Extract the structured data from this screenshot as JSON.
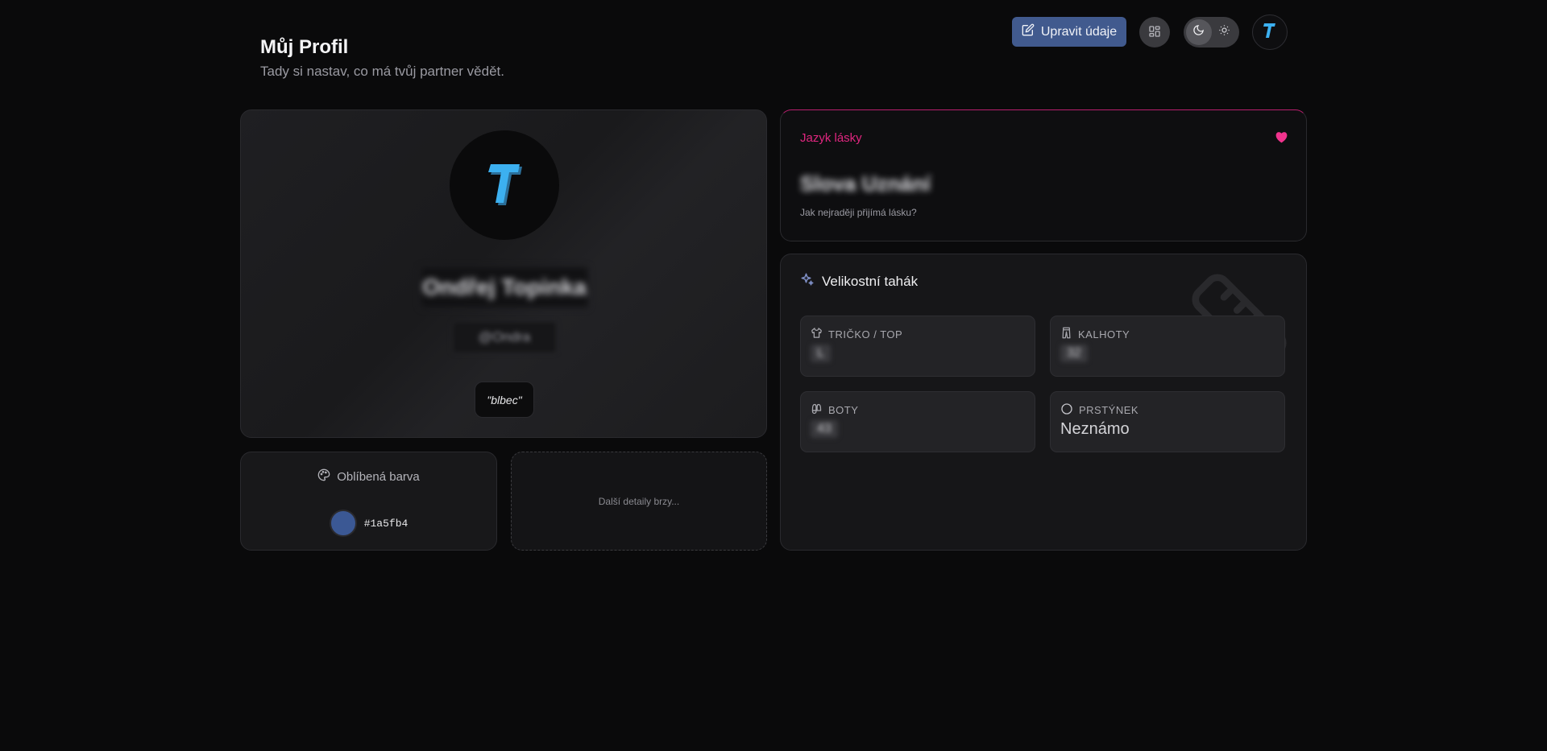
{
  "header": {
    "title": "Můj Profil",
    "subtitle": "Tady si nastav, co má tvůj partner vědět.",
    "edit_button": "Upravit údaje",
    "avatar_letter": "T"
  },
  "profile": {
    "avatar_letter": "T",
    "name": "Ondřej Topinka",
    "handle": "@Ondra",
    "quote": "\"blbec\""
  },
  "love_language": {
    "label": "Jazyk lásky",
    "value": "Slova Uznání",
    "caption": "Jak nejraději přijímá lásku?"
  },
  "sizes": {
    "title": "Velikostní tahák",
    "items": [
      {
        "label": "TRIČKO / TOP",
        "value": "L",
        "icon": "shirt-icon"
      },
      {
        "label": "KALHOTY",
        "value": "32",
        "icon": "pants-icon"
      },
      {
        "label": "BOTY",
        "value": "43",
        "icon": "shoe-icon"
      },
      {
        "label": "PRSTÝNEK",
        "value": "Neznámo",
        "icon": "ring-icon"
      }
    ]
  },
  "favorite_color": {
    "label": "Oblíbená barva",
    "hex": "#1a5fb4",
    "swatch": "#3b5894"
  },
  "more": {
    "text": "Další detaily brzy..."
  },
  "colors": {
    "accent": "#415a8e",
    "love": "#e0267f",
    "logo": "#3cb0f0"
  }
}
